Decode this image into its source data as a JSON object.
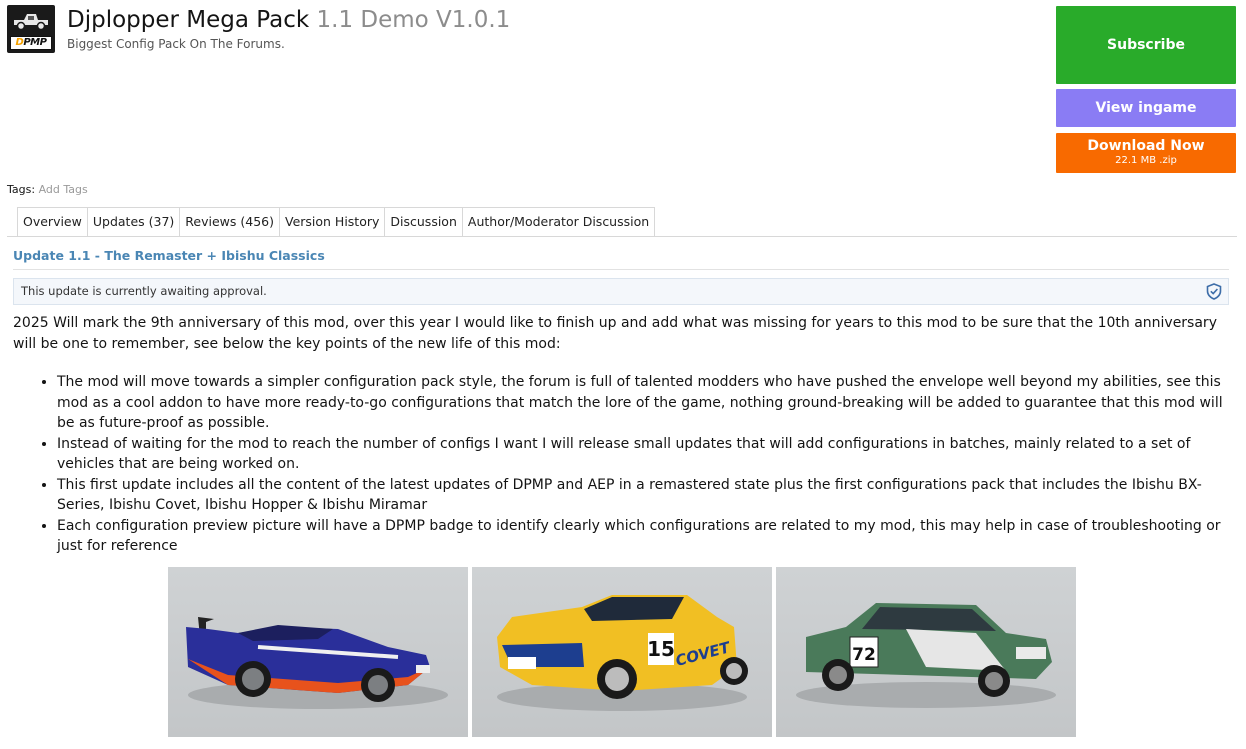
{
  "header": {
    "title": "Djplopper Mega Pack",
    "version": "1.1 Demo V1.0.1",
    "tagline": "Biggest Config Pack On The Forums.",
    "logo_badge_d": "D",
    "logo_badge_rest": "PMP"
  },
  "actions": {
    "subscribe": "Subscribe",
    "view_ingame": "View ingame",
    "download_label": "Download Now",
    "download_meta": "22.1 MB .zip"
  },
  "tags": {
    "label": "Tags:",
    "add": "Add Tags"
  },
  "tabs": [
    {
      "label": "Overview"
    },
    {
      "label": "Updates (37)"
    },
    {
      "label": "Reviews (456)"
    },
    {
      "label": "Version History"
    },
    {
      "label": "Discussion"
    },
    {
      "label": "Author/Moderator Discussion"
    }
  ],
  "update": {
    "title": "Update 1.1 - The Remaster + Ibishu Classics",
    "notice": "This update is currently awaiting approval.",
    "intro": "2025 Will mark the 9th anniversary of this mod, over this year I would like to finish up and add what was missing for years to this mod to be sure that the 10th anniversary will be one to remember, see below the key points of the new life of this mod:",
    "bullets": [
      "The mod will move towards a simpler configuration pack style, the forum is full of talented modders who have pushed the envelope well beyond my abilities, see this mod as a cool addon to have more ready-to-go configurations that match the lore of the game, nothing ground-breaking will be added to guarantee that this mod will be as future-proof as possible.",
      "Instead of waiting for the mod to reach the number of configs I want I will release small updates that will add configurations in batches, mainly related to a set of vehicles that are being worked on.",
      "This first update includes all the content of the latest updates of DPMP and AEP in a remastered state plus the first configurations pack that includes the Ibishu BX-Series, Ibishu Covet, Ibishu Hopper & Ibishu Miramar",
      "Each configuration preview picture will have a DPMP badge to identify clearly which configurations are related to my mod, this may help in case of troubleshooting or just for reference"
    ]
  },
  "gallery": {
    "car2_number": "15",
    "car2_sponsor": "COVET",
    "car3_number": "72"
  },
  "colors": {
    "subscribe": "#29ab2a",
    "view_ingame": "#8a7cf4",
    "download": "#f86a00",
    "link": "#4a86b4"
  }
}
